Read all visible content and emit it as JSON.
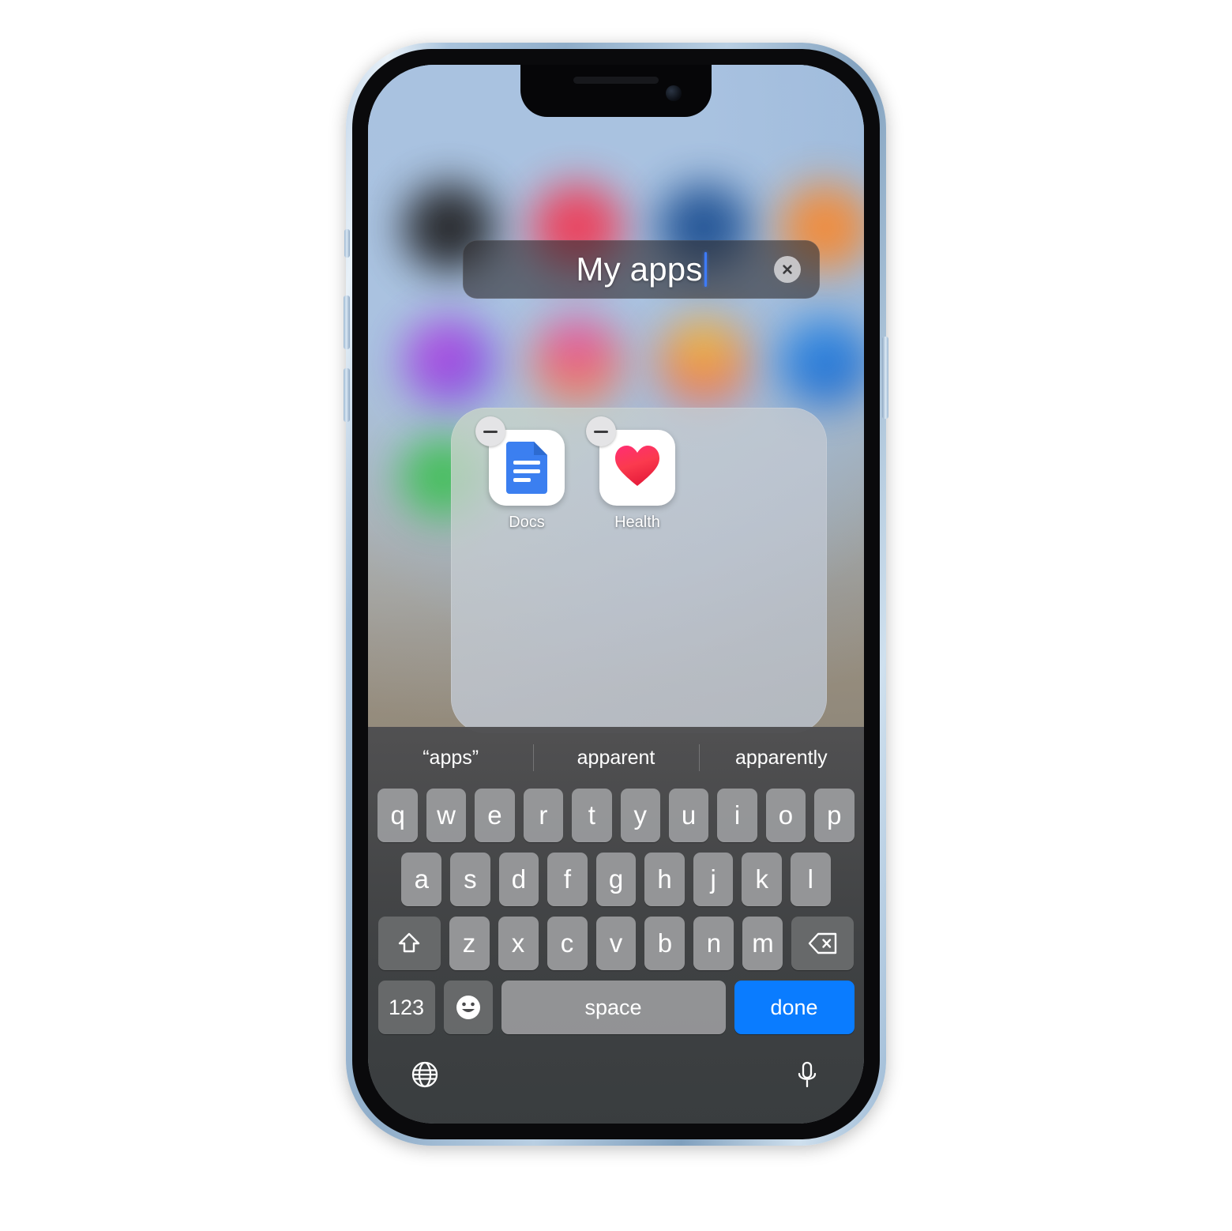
{
  "device": {
    "model_hint": "iphone",
    "frame_color": "#a9c3dc"
  },
  "folder_rename": {
    "value": "My apps",
    "placeholder": "Folder Name",
    "clear_icon": "close-circle-icon",
    "caret_color": "#3d7bfb"
  },
  "folder": {
    "apps": [
      {
        "label": "Docs",
        "icon": "google-docs-icon",
        "badge": "remove-minus-badge"
      },
      {
        "label": "Health",
        "icon": "apple-health-heart-icon",
        "badge": "remove-minus-badge"
      }
    ]
  },
  "keyboard": {
    "predictions": [
      "“apps”",
      "apparent",
      "apparently"
    ],
    "row1": [
      "q",
      "w",
      "e",
      "r",
      "t",
      "y",
      "u",
      "i",
      "o",
      "p"
    ],
    "row2": [
      "a",
      "s",
      "d",
      "f",
      "g",
      "h",
      "j",
      "k",
      "l"
    ],
    "row3": [
      "z",
      "x",
      "c",
      "v",
      "b",
      "n",
      "m"
    ],
    "shift_label": "shift",
    "backspace_label": "delete",
    "numbers_key": "123",
    "emoji_key": "emoji",
    "space_key": "space",
    "return_key": "done",
    "globe_key": "globe",
    "dictation_key": "microphone",
    "return_key_color": "#0a7cff"
  }
}
